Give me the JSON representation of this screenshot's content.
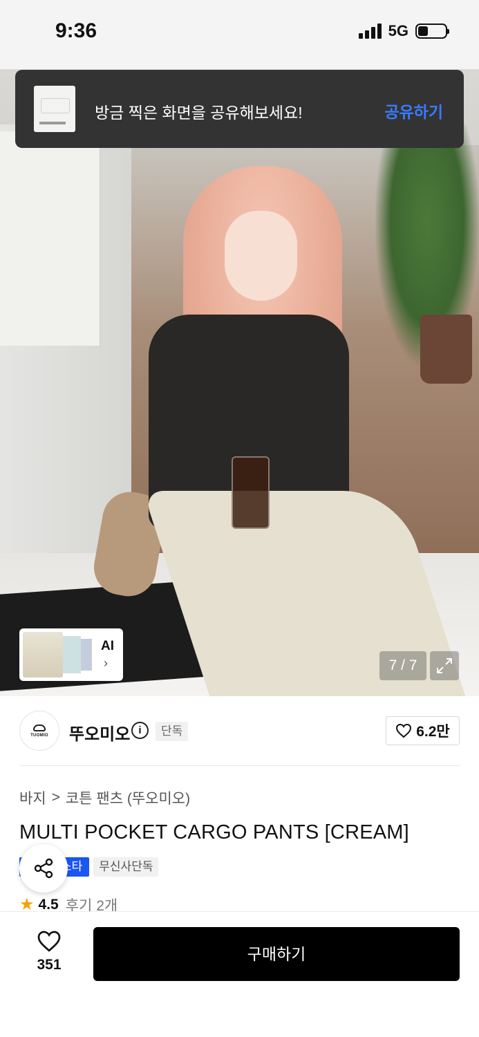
{
  "status_bar": {
    "time": "9:36",
    "network": "5G"
  },
  "toast": {
    "message": "방금 찍은 화면을 공유해보세요!",
    "action": "공유하기",
    "action_color": "#3a7bff"
  },
  "gallery": {
    "counter": "7 / 7",
    "ai_label": "AI",
    "ai_chevron": "›"
  },
  "brand": {
    "logo_text": "TUOMIO",
    "name": "뚜오미오",
    "info_icon": "i",
    "badge": "단독",
    "likes": "6.2만"
  },
  "product": {
    "breadcrumb": [
      "바지",
      ">",
      "코튼 팬츠 (뚜오미오)"
    ],
    "title": "MULTI POCKET CARGO PANTS [CREAM]",
    "tag_blue": "스타",
    "tag_grey": "무신사단독",
    "rating": "4.5",
    "review_count": "후기 2개"
  },
  "bottom_bar": {
    "wish_count": "351",
    "buy_label": "구매하기"
  },
  "colors": {
    "accent_blue": "#1a56f4",
    "star": "#f5a000",
    "buy_button": "#000000"
  }
}
